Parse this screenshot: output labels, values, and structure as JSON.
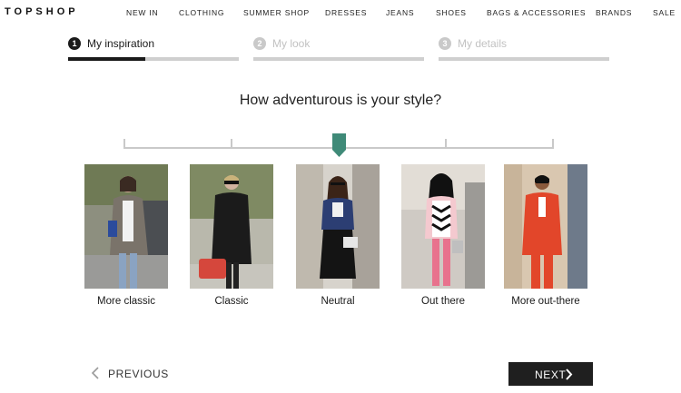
{
  "brand": "TOPSHOP",
  "nav": [
    "NEW IN",
    "CLOTHING",
    "SUMMER SHOP",
    "DRESSES",
    "JEANS",
    "SHOES",
    "BAGS & ACCESSORIES",
    "BRANDS",
    "SALE"
  ],
  "steps": [
    {
      "number": "1",
      "label": "My inspiration",
      "state": "active",
      "progress": 0.45
    },
    {
      "number": "2",
      "label": "My look",
      "state": "inactive",
      "progress": 0
    },
    {
      "number": "3",
      "label": "My details",
      "state": "inactive",
      "progress": 0
    }
  ],
  "question": "How adventurous is your style?",
  "slider": {
    "stops": 5,
    "selected_index": 2,
    "handle_color": "#3f8a78"
  },
  "options": [
    {
      "label": "More classic"
    },
    {
      "label": "Classic"
    },
    {
      "label": "Neutral"
    },
    {
      "label": "Out there"
    },
    {
      "label": "More out-there"
    }
  ],
  "buttons": {
    "previous": "PREVIOUS",
    "next": "NEXT"
  },
  "icons": {
    "previous": "chevron-left-icon",
    "next": "chevron-right-icon"
  }
}
